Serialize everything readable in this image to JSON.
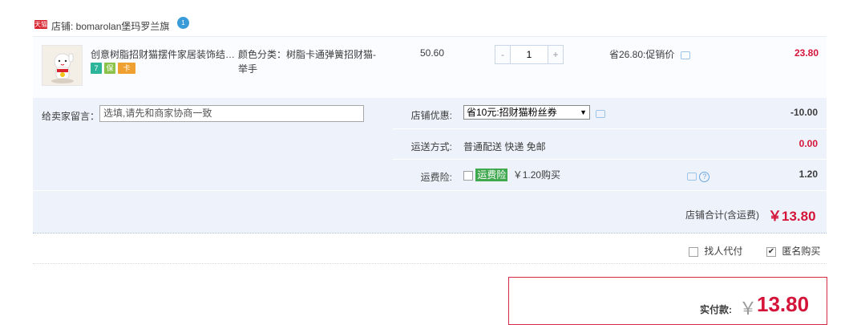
{
  "store": {
    "badge": "天猫",
    "label": "店铺: bomarolan堡玛罗兰旗",
    "ww_icon": "1"
  },
  "item": {
    "name": "创意树脂招财猫摆件家居装饰结…",
    "sku": "颜色分类：树脂卡通弹簧招财猫-举手",
    "price": "50.60",
    "qty": {
      "minus": "-",
      "value": "1",
      "plus": "+"
    },
    "promo": "省26.80:促销价",
    "subtotal": "23.80",
    "service_icons": {
      "seven_day": "7",
      "guarantee": "保",
      "card": "卡"
    }
  },
  "options": {
    "message_label": "给卖家留言：",
    "message_placeholder": "选填,请先和商家协商一致",
    "coupon_label": "店铺优惠:",
    "coupon_selected": "省10元:招财猫粉丝券",
    "coupon_value": "-10.00",
    "shipping_label": "运送方式:",
    "shipping_method": "普通配送 快递 免邮",
    "shipping_value": "0.00",
    "insurance_label": "运费险:",
    "insurance_tag": "运费险",
    "insurance_price": "￥1.20购买",
    "insurance_value": "1.20",
    "store_total_label": "店铺合计(含运费)",
    "store_total_value": "￥13.80"
  },
  "footer": {
    "pay_for_me_label": "找人代付",
    "anonymous_label": "匿名购买",
    "anonymous_checked": true,
    "actual_label": "实付款:",
    "currency": "￥",
    "actual_value": "13.80"
  },
  "colors": {
    "price_red": "#d5143a",
    "options_bg": "#eef3fb",
    "insurance_green": "#40a84f"
  }
}
